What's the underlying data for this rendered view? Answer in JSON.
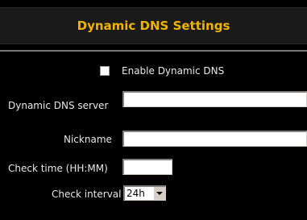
{
  "header": {
    "title": "Dynamic DNS Settings"
  },
  "enable": {
    "label": "Enable Dynamic DNS",
    "checked": false
  },
  "fields": {
    "server_label": "Dynamic DNS server",
    "server_value": "",
    "nickname_label": "Nickname",
    "nickname_value": "",
    "check_time_label": "Check time (HH:MM)",
    "check_time_value": "",
    "interval_label": "Check interval",
    "interval_value": "24h"
  },
  "colors": {
    "background": "#000000",
    "title": "#f0b400",
    "header_bg": "#1a1a1a",
    "text": "#e8e8e8"
  }
}
